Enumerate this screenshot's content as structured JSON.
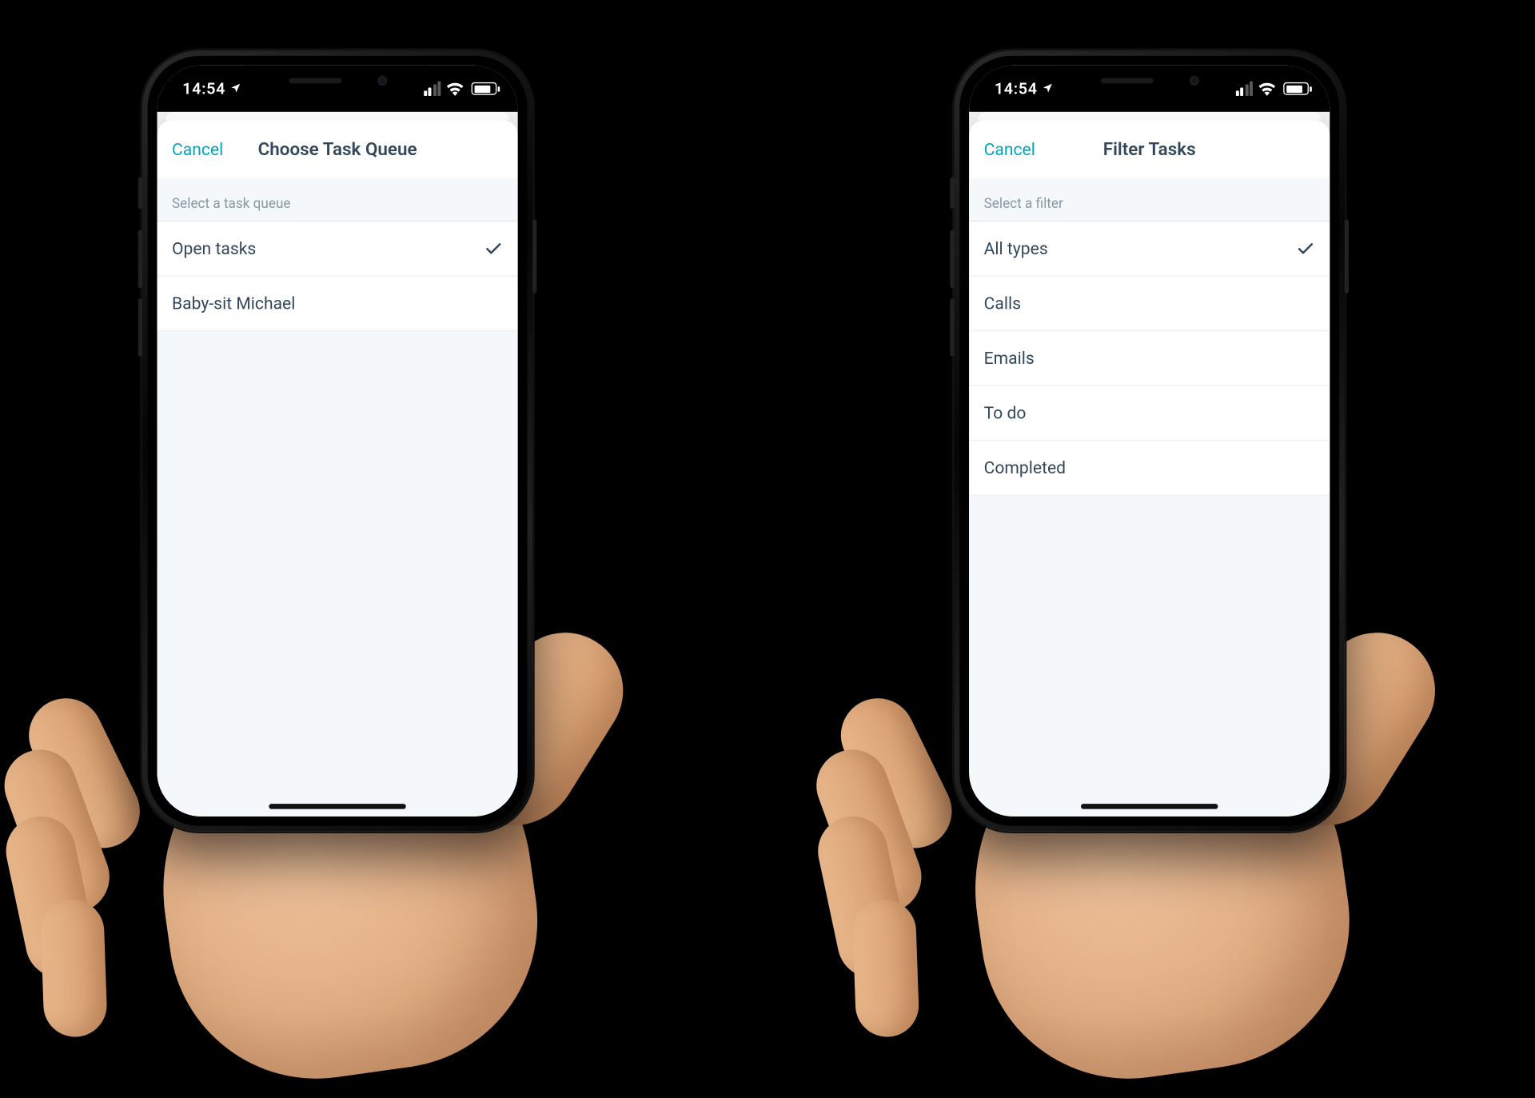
{
  "status": {
    "time": "14:54"
  },
  "phones": [
    {
      "header": {
        "cancel": "Cancel",
        "title": "Choose Task Queue"
      },
      "section_label": "Select a task queue",
      "items": [
        {
          "label": "Open tasks",
          "selected": true
        },
        {
          "label": "Baby-sit Michael",
          "selected": false
        }
      ]
    },
    {
      "header": {
        "cancel": "Cancel",
        "title": "Filter Tasks"
      },
      "section_label": "Select a filter",
      "items": [
        {
          "label": "All types",
          "selected": true
        },
        {
          "label": "Calls",
          "selected": false
        },
        {
          "label": "Emails",
          "selected": false
        },
        {
          "label": "To do",
          "selected": false
        },
        {
          "label": "Completed",
          "selected": false
        }
      ]
    }
  ]
}
